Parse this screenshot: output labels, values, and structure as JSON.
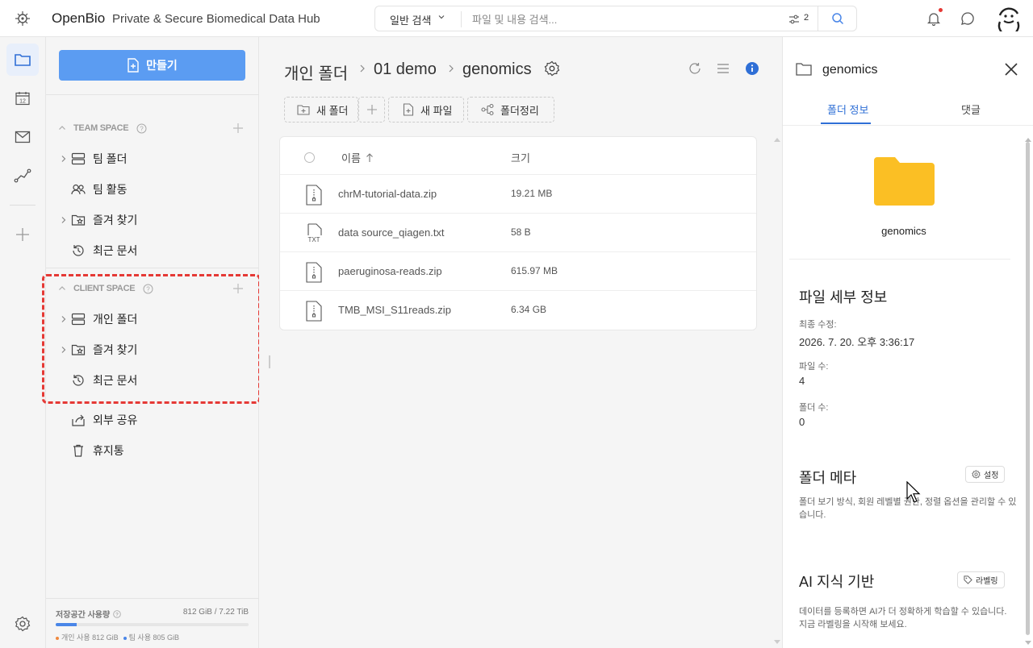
{
  "app": {
    "brand": "OpenBio",
    "tagline": "Private & Secure Biomedical Data Hub"
  },
  "search": {
    "type_label": "일반 검색",
    "placeholder": "파일 및 내용 검색...",
    "filter_count": "2"
  },
  "sidebar": {
    "create_label": "만들기",
    "team_space": {
      "label": "TEAM SPACE",
      "items": [
        {
          "label": "팀 폴더",
          "icon": "server-folder-icon"
        },
        {
          "label": "팀 활동",
          "icon": "people-icon"
        },
        {
          "label": "즐겨 찾기",
          "icon": "star-folder-icon"
        },
        {
          "label": "최근 문서",
          "icon": "history-icon"
        }
      ]
    },
    "client_space": {
      "label": "CLIENT SPACE",
      "items": [
        {
          "label": "개인 폴더",
          "icon": "server-folder-icon"
        },
        {
          "label": "즐겨 찾기",
          "icon": "star-folder-icon"
        },
        {
          "label": "최근 문서",
          "icon": "history-icon"
        }
      ]
    },
    "extra_items": [
      {
        "label": "외부 공유",
        "icon": "share-icon"
      },
      {
        "label": "휴지통",
        "icon": "trash-icon"
      }
    ],
    "storage": {
      "label": "저장공간 사용량",
      "value": "812 GiB / 7.22 TiB",
      "used_fraction": 0.11,
      "personal": "개인 사용 812 GiB",
      "team": "팀 사용 805 GiB",
      "personal_color": "#f0883e",
      "team_color": "#4a86e8"
    }
  },
  "breadcrumb": {
    "items": [
      "개인 폴더",
      "01 demo",
      "genomics"
    ]
  },
  "toolbar": {
    "new_folder": "새 폴더",
    "new_file": "새 파일",
    "organize": "폴더정리"
  },
  "table": {
    "col_name": "이름",
    "col_size": "크기",
    "rows": [
      {
        "name": "chrM-tutorial-data.zip",
        "size": "19.21 MB",
        "type": "zip"
      },
      {
        "name": "data source_qiagen.txt",
        "size": "58 B",
        "type": "txt"
      },
      {
        "name": "paeruginosa-reads.zip",
        "size": "615.97 MB",
        "type": "zip"
      },
      {
        "name": "TMB_MSI_S11reads.zip",
        "size": "6.34 GB",
        "type": "zip"
      }
    ]
  },
  "panel": {
    "title": "genomics",
    "tabs": [
      "폴더 정보",
      "댓글"
    ],
    "folder_name": "genomics",
    "details_title": "파일 세부 정보",
    "modified_label": "최종 수정:",
    "modified_value": "2026. 7. 20. 오후 3:36:17",
    "file_count_label": "파일 수:",
    "file_count_value": "4",
    "folder_count_label": "폴더 수:",
    "folder_count_value": "0",
    "meta_title": "폴더 메타",
    "meta_button": "설정",
    "meta_desc": "폴더 보기 방식, 회원 레벨별 권한, 정렬 옵션을 관리할 수 있습니다.",
    "ai_title": "AI 지식 기반",
    "ai_button": "라벨링",
    "ai_desc": "데이터를 등록하면 AI가 더 정확하게 학습할 수 있습니다. 지금 라벨링을 시작해 보세요."
  },
  "colors": {
    "accent": "#5b9cf2",
    "tab_active": "#2f6fd6",
    "folder_yellow": "#fbbf24",
    "highlight_red": "#e53935"
  }
}
